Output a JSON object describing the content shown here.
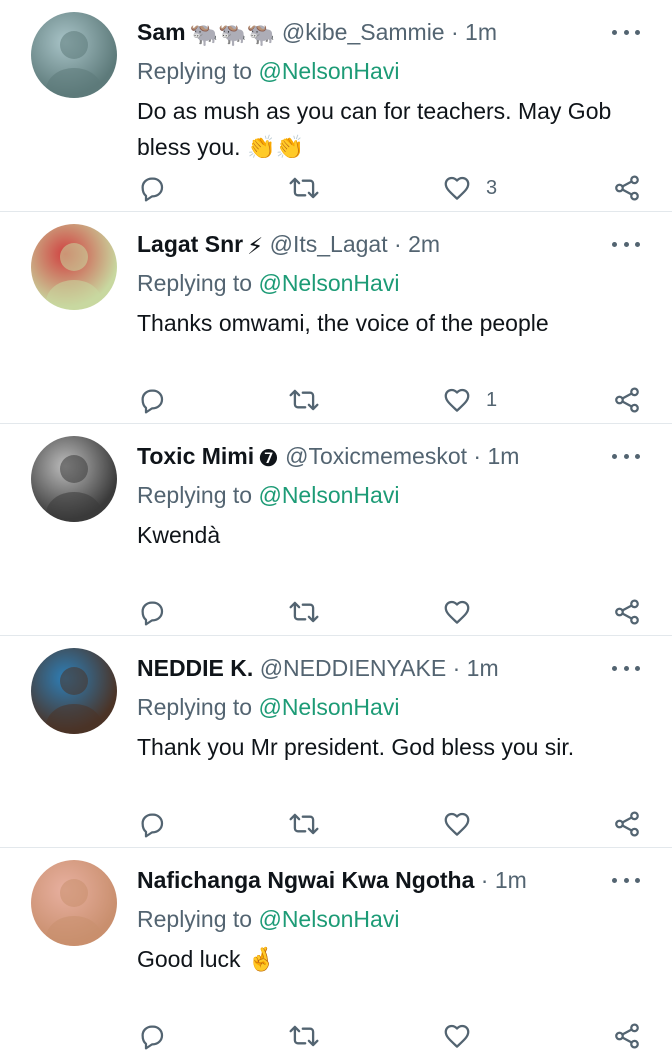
{
  "replies": [
    {
      "name": "Sam",
      "handle": "@kibe_Sammie",
      "time": "1m",
      "name_emoji": "🐃🐃🐃",
      "replying_prefix": "Replying to",
      "replying_to": "@NelsonHavi",
      "text": "Do as mush as you can for teachers. May Gob bless you. 👏👏",
      "like_count": "3",
      "avatar_colors": [
        "#5d7a7a",
        "#a9c4c8"
      ]
    },
    {
      "name": "Lagat Snr",
      "handle": "@Its_Lagat",
      "time": "2m",
      "name_emoji": "⚡",
      "replying_prefix": "Replying to",
      "replying_to": "@NelsonHavi",
      "text": "Thanks omwami, the voice of the people",
      "like_count": "1",
      "avatar_colors": [
        "#c8d8a0",
        "#d04040"
      ]
    },
    {
      "name": "Toxic Mimi",
      "handle": "@Toxicmemeskot",
      "time": "1m",
      "name_emoji": "❼",
      "replying_prefix": "Replying to",
      "replying_to": "@NelsonHavi",
      "text": "Kwendà",
      "like_count": "",
      "avatar_colors": [
        "#3a3a3a",
        "#bdbdbd"
      ]
    },
    {
      "name": "NEDDIE K.",
      "handle": "@NEDDIENYAKE",
      "time": "1m",
      "name_emoji": "",
      "replying_prefix": "Replying to",
      "replying_to": "@NelsonHavi",
      "text": "Thank you Mr president. God bless you sir.",
      "like_count": "",
      "avatar_colors": [
        "#4b3326",
        "#2d7fb8"
      ]
    },
    {
      "name": "Nafichanga Ngwai Kwa Ngotha",
      "handle": "",
      "time": "1m",
      "name_emoji": "",
      "replying_prefix": "Replying to",
      "replying_to": "@NelsonHavi",
      "text": "Good luck 🤞",
      "like_count": "",
      "avatar_colors": [
        "#c98f6e",
        "#e8b0a0"
      ]
    }
  ],
  "icons": {
    "reply": "reply-icon",
    "retweet": "retweet-icon",
    "like": "heart-icon",
    "share": "share-icon",
    "more": "more-icon"
  }
}
